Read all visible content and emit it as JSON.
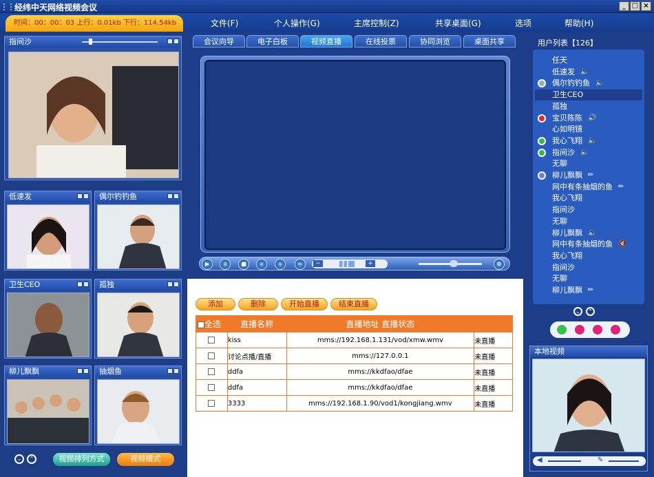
{
  "window": {
    "title": "经纬中天网络视频会议",
    "min": "_",
    "max": "□",
    "close": "×"
  },
  "status_text": "时间：00：00：03 上行：0.01kb 下行：114.54kb",
  "menu": [
    "文件(F)",
    "个人操作(G)",
    "主席控制(Z)",
    "共享桌面(G)",
    "选项",
    "帮助(H)"
  ],
  "left": {
    "main_video": {
      "name": "指间沙"
    },
    "tiles": [
      "低速发",
      "偶尔钓钓鱼",
      "卫生CEO",
      "孤独",
      "柳儿飘飘",
      "抽烟鱼"
    ],
    "bottom_buttons": [
      "视频排列方式",
      "视频模式"
    ]
  },
  "tabs": [
    "会议向导",
    "电子白板",
    "视频直播",
    "在线投票",
    "协同浏览",
    "桌面共享"
  ],
  "active_tab": "视频直播",
  "actions": [
    "添加",
    "删除",
    "开始直播",
    "结束直播"
  ],
  "table": {
    "select_all": "全选",
    "headers": [
      "直播名称",
      "直播地址  直播状态",
      ""
    ],
    "rows": [
      {
        "name": "kiss",
        "url": "mms://192.168.1.131/vod/xmw.wmv",
        "status": "未直播"
      },
      {
        "name": "讨论点播/直播",
        "url": "mms://127.0.0.1",
        "status": "未直播"
      },
      {
        "name": "ddfa",
        "url": "mms://kkdfao/dfae",
        "status": "未直播"
      },
      {
        "name": "ddfa",
        "url": "mms://kkdfao/dfae",
        "status": "未直播"
      },
      {
        "name": "3333",
        "url": "mms://192.168.1.90/vod1/kongjiang.wmv",
        "status": "未直播"
      }
    ]
  },
  "users": {
    "title": "用户列表【126】",
    "list": [
      {
        "name": "任天"
      },
      {
        "name": "低速发",
        "extra": "🔈"
      },
      {
        "name": "偶尔钓钓鱼",
        "extra": "🔈",
        "dot": "#9aa9c8"
      },
      {
        "name": "卫生CEO",
        "selected": true
      },
      {
        "name": "孤独"
      },
      {
        "name": "宝贝陈陈",
        "extra": "🔊",
        "dot": "#e8242d"
      },
      {
        "name": "心如明镜"
      },
      {
        "name": "我心飞翔",
        "extra": "🔈",
        "dot": "#39b54a"
      },
      {
        "name": "指间沙",
        "extra": "🔈",
        "dot": "#39b54a"
      },
      {
        "name": "无聊"
      },
      {
        "name": "柳儿飘飘",
        "extra": "✏",
        "dot": "#6f7fe0"
      },
      {
        "name": "网中有条抽烟的鱼",
        "extra": "✏"
      },
      {
        "name": "我心飞翔"
      },
      {
        "name": "指间沙"
      },
      {
        "name": "无聊"
      },
      {
        "name": "柳儿飘飘",
        "extra": "🔈"
      },
      {
        "name": "网中有条抽烟的鱼",
        "extra": "🔇"
      },
      {
        "name": "我心飞翔"
      },
      {
        "name": "指间沙"
      },
      {
        "name": "无聊"
      },
      {
        "name": "柳儿飘飘",
        "extra": "✏"
      }
    ]
  },
  "local_video": {
    "title": "本地视频"
  },
  "colors": {
    "accent": "#f07a2a",
    "panel": "#2b4f9c",
    "status": "#b3180a"
  }
}
